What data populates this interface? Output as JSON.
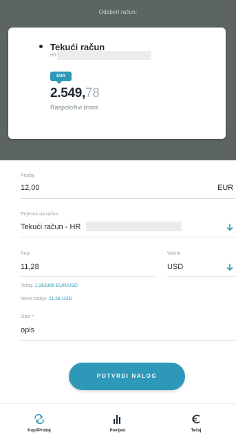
{
  "header": {
    "title": "Odaberi račun:"
  },
  "account_card": {
    "name": "Tekući račun",
    "iban_prefix": "HR",
    "currency": "EUR",
    "amount_int": "2.549,",
    "amount_dec": "78",
    "amount_label": "Raspoloživi iznos"
  },
  "form": {
    "sell": {
      "label": "Prodaj",
      "value": "12,00",
      "currency": "EUR"
    },
    "transfer": {
      "label": "Prijenos na račun",
      "value": "Tekući račun - HR"
    },
    "buy": {
      "label": "Kupi",
      "value": "11,28"
    },
    "currency": {
      "label": "Valuta",
      "value": "USD"
    },
    "rate": {
      "label": "Tečaj:",
      "value": "1,063365 EUR/USD"
    },
    "new_balance": {
      "label": "Novo stanje:",
      "value": "11,28 USD"
    },
    "description": {
      "label": "Opis *",
      "value": "opis"
    }
  },
  "confirm_button": {
    "label": "POTVRDI NALOG"
  },
  "bottom_nav": {
    "items": [
      {
        "label": "Kupi/Prodaj",
        "icon": "exchange-icon"
      },
      {
        "label": "Povijest",
        "icon": "bar-chart-icon"
      },
      {
        "label": "Tečaj",
        "icon": "euro-icon"
      }
    ]
  },
  "colors": {
    "accent": "#2e98b8",
    "header_bg": "#5d6563",
    "text": "#1f2a33"
  }
}
